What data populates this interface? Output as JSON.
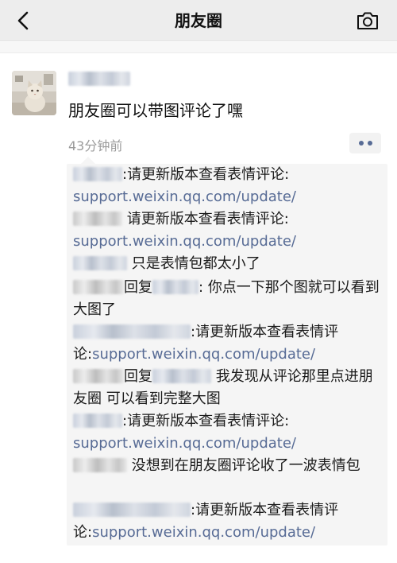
{
  "nav": {
    "title": "朋友圈",
    "back_icon": "chevron-left-icon",
    "camera_icon": "camera-icon"
  },
  "post": {
    "text": "朋友圈可以带图评论了嘿",
    "time": "43分钟前"
  },
  "reply_word": "回复",
  "comments": [
    {
      "type": "plain",
      "sep": ":",
      "text": "请更新版本查看表情评论:",
      "link": "support.weixin.qq.com/update/"
    },
    {
      "type": "plain",
      "sep": "",
      "text": "请更新版本查看表情评论:",
      "link": "support.weixin.qq.com/update/"
    },
    {
      "type": "plain",
      "sep": "",
      "text": "只是表情包都太小了"
    },
    {
      "type": "reply",
      "sep": ":",
      "text": "你点一下那个图就可以看到大图了"
    },
    {
      "type": "plain",
      "sep": ":",
      "text": "请更新版本查看表情评论:",
      "link": "support.weixin.qq.com/update/"
    },
    {
      "type": "reply",
      "sep": "",
      "text": "我发现从评论那里点进朋友圈 可以看到完整大图"
    },
    {
      "type": "plain",
      "sep": ":",
      "text": "请更新版本查看表情评论:",
      "link": "support.weixin.qq.com/update/"
    },
    {
      "type": "plain",
      "sep": "",
      "text": "没想到在朋友圈评论收了一波表情包"
    },
    {
      "type": "plain",
      "sep": ":",
      "text": "请更新版本查看表情评论:",
      "link": "support.weixin.qq.com/update/"
    }
  ],
  "colors": {
    "link": "#576b95",
    "nav_bg": "#ededed",
    "comment_bg": "#f5f5f5",
    "time": "#9a9a9a"
  }
}
